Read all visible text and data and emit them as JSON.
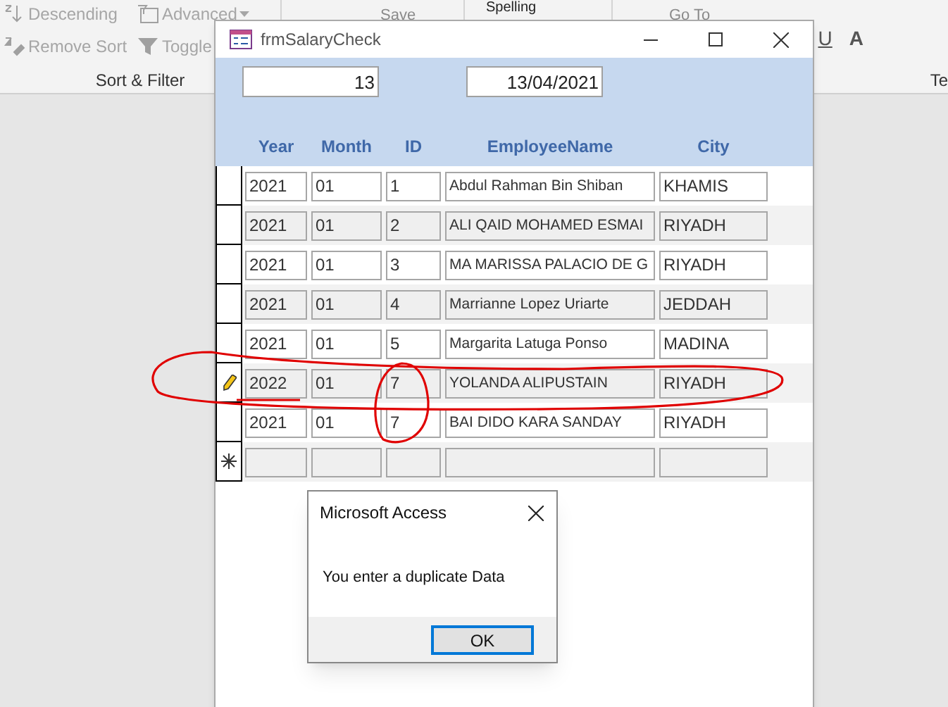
{
  "ribbon": {
    "sort_filter": {
      "items": [
        {
          "label": "Descending",
          "dropdown": false
        },
        {
          "label": "Advanced",
          "dropdown": true
        },
        {
          "label": "Remove Sort",
          "dropdown": false
        },
        {
          "label": "Toggle",
          "dropdown": false
        }
      ],
      "label": "Sort & Filter"
    },
    "records": {
      "items": [
        "Save"
      ]
    },
    "proofing": {
      "items": [
        "Spelling"
      ]
    },
    "find": {
      "items": [
        "Go To"
      ]
    },
    "text_formatting": {
      "items": [
        "U",
        "A"
      ],
      "label": "Te"
    }
  },
  "form": {
    "title": "frmSalaryCheck",
    "header_fields": [
      {
        "value": "13"
      },
      {
        "value": "13/04/2021"
      }
    ],
    "columns": [
      "Year",
      "Month",
      "ID",
      "EmployeeName",
      "City"
    ],
    "rows": [
      {
        "kind": "record",
        "editing": false,
        "cells": [
          "2021",
          "01",
          "1",
          "Abdul Rahman Bin Shiban",
          "KHAMIS"
        ]
      },
      {
        "kind": "record",
        "editing": false,
        "cells": [
          "2021",
          "01",
          "2",
          "ALI QAID MOHAMED ESMAI",
          "RIYADH"
        ]
      },
      {
        "kind": "record",
        "editing": false,
        "cells": [
          "2021",
          "01",
          "3",
          "MA MARISSA PALACIO DE G",
          "RIYADH"
        ]
      },
      {
        "kind": "record",
        "editing": false,
        "cells": [
          "2021",
          "01",
          "4",
          "Marrianne Lopez Uriarte",
          "JEDDAH"
        ]
      },
      {
        "kind": "record",
        "editing": false,
        "cells": [
          "2021",
          "01",
          "5",
          "Margarita Latuga Ponso",
          "MADINA"
        ]
      },
      {
        "kind": "record",
        "editing": true,
        "cells": [
          "2022",
          "01",
          "7",
          "YOLANDA ALIPUSTAIN",
          "RIYADH"
        ]
      },
      {
        "kind": "record",
        "editing": false,
        "cells": [
          "2021",
          "01",
          "7",
          "BAI DIDO KARA SANDAY",
          "RIYADH"
        ]
      },
      {
        "kind": "new"
      }
    ]
  },
  "dialog": {
    "title": "Microsoft Access",
    "message": "You enter a duplicate Data",
    "buttons": [
      {
        "label": "OK",
        "default": true
      }
    ]
  }
}
